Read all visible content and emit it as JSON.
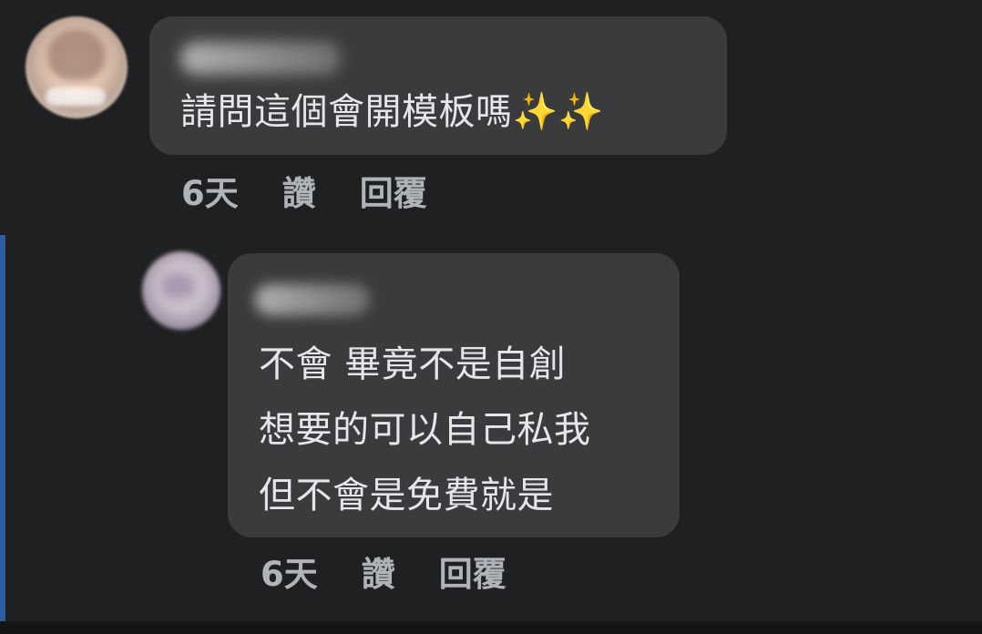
{
  "thread": {
    "comment": {
      "author": "",
      "text": "請問這個會開模板嗎✨✨",
      "meta": {
        "time": "6天",
        "like_label": "讚",
        "reply_label": "回覆"
      }
    },
    "reply": {
      "author": "",
      "lines": [
        "不會 畢竟不是自創",
        "想要的可以自己私我",
        "但不會是免費就是"
      ],
      "meta": {
        "time": "6天",
        "like_label": "讚",
        "reply_label": "回覆"
      }
    }
  },
  "colors": {
    "background": "#18191a",
    "bubble": "#3a3b3c",
    "text": "#e4e6eb",
    "meta": "#b0b3b8",
    "reply_indicator": "#2d5ea5"
  }
}
